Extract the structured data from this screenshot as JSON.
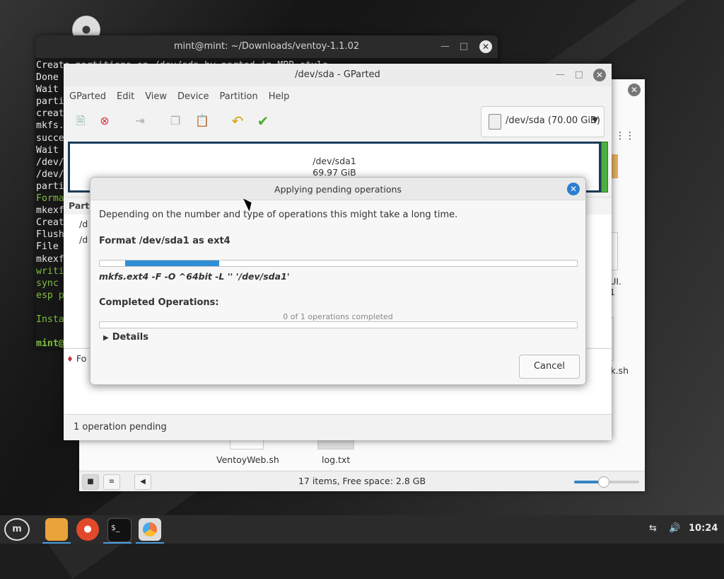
{
  "terminal": {
    "title": "mint@mint: ~/Downloads/ventoy-1.1.02",
    "lines": [
      {
        "text": "Create partitions on /dev/sda by parted in MBR style",
        "style": "normal"
      },
      {
        "text": "Done",
        "style": "normal"
      },
      {
        "text": "Wait",
        "style": "normal"
      },
      {
        "text": "parti",
        "style": "normal"
      },
      {
        "text": "creat",
        "style": "normal"
      },
      {
        "text": "mkfs.",
        "style": "normal"
      },
      {
        "text": "succe",
        "style": "normal"
      },
      {
        "text": "Wait",
        "style": "normal"
      },
      {
        "text": "/dev/",
        "style": "normal"
      },
      {
        "text": "/dev/",
        "style": "normal"
      },
      {
        "text": "parti",
        "style": "normal"
      },
      {
        "text": "Forma",
        "style": "green"
      },
      {
        "text": "mkexf",
        "style": "normal"
      },
      {
        "text": "Creat",
        "style": "normal"
      },
      {
        "text": "Flush",
        "style": "normal"
      },
      {
        "text": "File",
        "style": "normal"
      },
      {
        "text": "mkexf",
        "style": "normal"
      },
      {
        "text": "writi",
        "style": "green"
      },
      {
        "text": "sync",
        "style": "green"
      },
      {
        "text": "esp p",
        "style": "green"
      },
      {
        "text": "",
        "style": "normal"
      },
      {
        "text": "Insta",
        "style": "green"
      },
      {
        "text": "",
        "style": "normal"
      },
      {
        "text": "mint@",
        "style": "prompt"
      }
    ]
  },
  "files": {
    "status": "17 items, Free space: 2.8 GB",
    "zoom_level": 0.45,
    "visible_files": [
      "VentoyWeb.sh",
      "log.txt"
    ],
    "partial_labels": [
      "UI.",
      "1",
      "k.sh"
    ]
  },
  "gparted": {
    "title": "/dev/sda - GParted",
    "menu": [
      "GParted",
      "Edit",
      "View",
      "Device",
      "Partition",
      "Help"
    ],
    "device_selector": "/dev/sda (70.00 GiB)",
    "disk_map": {
      "name": "/dev/sda1",
      "size": "69.97 GiB"
    },
    "partition_header": "Partition",
    "partition_rows": [
      "/d",
      "/d"
    ],
    "pending_op": "Fo",
    "status": "1 operation pending"
  },
  "dialog": {
    "title": "Applying pending operations",
    "intro": "Depending on the number and type of operations this might take a long time.",
    "current_op": "Format /dev/sda1 as ext4",
    "progress_start": 0.053,
    "progress_end": 0.25,
    "command": "mkfs.ext4 -F -O ^64bit -L '' '/dev/sda1'",
    "completed_label": "Completed Operations:",
    "completed_count": "0 of 1 operations completed",
    "completed_fraction": 0,
    "details_label": "Details",
    "cancel_label": "Cancel"
  },
  "taskbar": {
    "apps": [
      "menu-icon",
      "files-icon",
      "firefox-icon",
      "terminal-icon",
      "disks-icon"
    ],
    "clock": "10:24"
  }
}
